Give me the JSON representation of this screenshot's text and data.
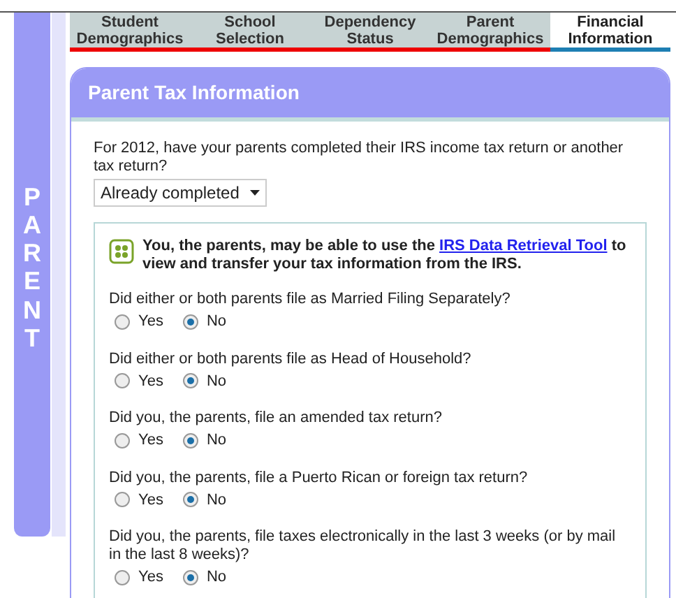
{
  "sidebar": {
    "label": "PARENT"
  },
  "tabs": [
    {
      "label": "Student Demographics",
      "selected": false
    },
    {
      "label": "School Selection",
      "selected": false
    },
    {
      "label": "Dependency Status",
      "selected": false
    },
    {
      "label": "Parent Demographics",
      "selected": false
    },
    {
      "label": "Financial Information",
      "selected": true
    }
  ],
  "panel": {
    "title": "Parent Tax Information",
    "question": "For 2012, have your parents completed their IRS income tax return or another tax return?",
    "dropdown": {
      "value": "Already completed"
    },
    "notice": {
      "before": "You, the parents, may be able to use the",
      "link": "IRS Data Retrieval Tool",
      "after": "to view and transfer your tax information from the IRS."
    },
    "questions": [
      {
        "text": "Did either or both parents file as Married Filing Separately?",
        "options": [
          {
            "label": "Yes",
            "selected": false
          },
          {
            "label": "No",
            "selected": true
          }
        ]
      },
      {
        "text": "Did either or both parents file as Head of Household?",
        "options": [
          {
            "label": "Yes",
            "selected": false
          },
          {
            "label": "No",
            "selected": true
          }
        ]
      },
      {
        "text": "Did you, the parents, file an amended tax return?",
        "options": [
          {
            "label": "Yes",
            "selected": false
          },
          {
            "label": "No",
            "selected": true
          }
        ]
      },
      {
        "text": "Did you, the parents, file a Puerto Rican or foreign tax return?",
        "options": [
          {
            "label": "Yes",
            "selected": false
          },
          {
            "label": "No",
            "selected": true
          }
        ]
      },
      {
        "text": "Did you, the parents, file taxes electronically in the last 3 weeks (or by mail in the last 8 weeks)?",
        "options": [
          {
            "label": "Yes",
            "selected": false
          },
          {
            "label": "No",
            "selected": true
          }
        ]
      }
    ]
  }
}
